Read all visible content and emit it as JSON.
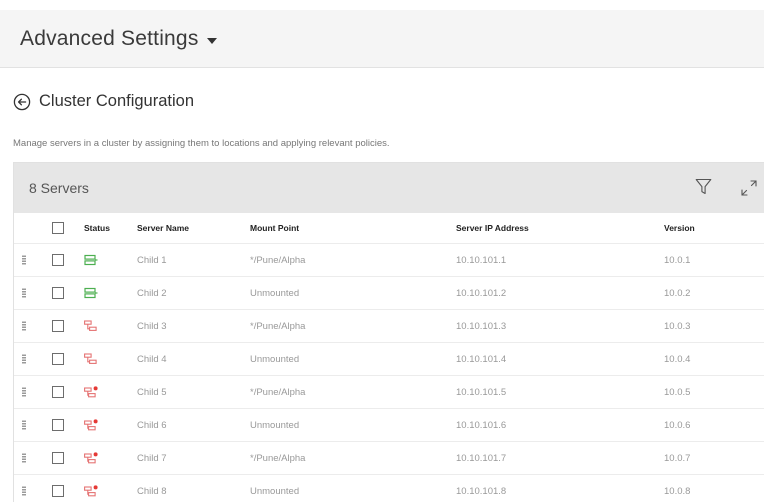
{
  "header": {
    "title": "Advanced Settings"
  },
  "page": {
    "title": "Cluster Configuration",
    "description": "Manage servers in a cluster by assigning them to locations and applying relevant policies."
  },
  "table": {
    "count_label": "8 Servers",
    "columns": {
      "status": "Status",
      "name": "Server Name",
      "mount": "Mount Point",
      "ip": "Server IP Address",
      "version": "Version"
    },
    "rows": [
      {
        "status": "online",
        "name": "Child 1",
        "mount": "*/Pune/Alpha",
        "ip": "10.10.101.1",
        "version": "10.0.1"
      },
      {
        "status": "online",
        "name": "Child 2",
        "mount": "Unmounted",
        "ip": "10.10.101.2",
        "version": "10.0.2"
      },
      {
        "status": "warning",
        "name": "Child 3",
        "mount": "*/Pune/Alpha",
        "ip": "10.10.101.3",
        "version": "10.0.3"
      },
      {
        "status": "warning",
        "name": "Child 4",
        "mount": "Unmounted",
        "ip": "10.10.101.4",
        "version": "10.0.4"
      },
      {
        "status": "error",
        "name": "Child 5",
        "mount": "*/Pune/Alpha",
        "ip": "10.10.101.5",
        "version": "10.0.5"
      },
      {
        "status": "error",
        "name": "Child 6",
        "mount": "Unmounted",
        "ip": "10.10.101.6",
        "version": "10.0.6"
      },
      {
        "status": "error",
        "name": "Child 7",
        "mount": "*/Pune/Alpha",
        "ip": "10.10.101.7",
        "version": "10.0.7"
      },
      {
        "status": "error",
        "name": "Child 8",
        "mount": "Unmounted",
        "ip": "10.10.101.8",
        "version": "10.0.8"
      }
    ]
  },
  "colors": {
    "status_online": "#4caf50",
    "status_warning": "#e57373",
    "status_error": "#e53935",
    "header_bg": "#f5f5f5",
    "card_header_bg": "#e6e6e6"
  },
  "icons": {
    "back": "circle-arrow-left-icon",
    "filter": "filter-icon",
    "expand": "expand-icon",
    "drag": "drag-handle-icon"
  }
}
